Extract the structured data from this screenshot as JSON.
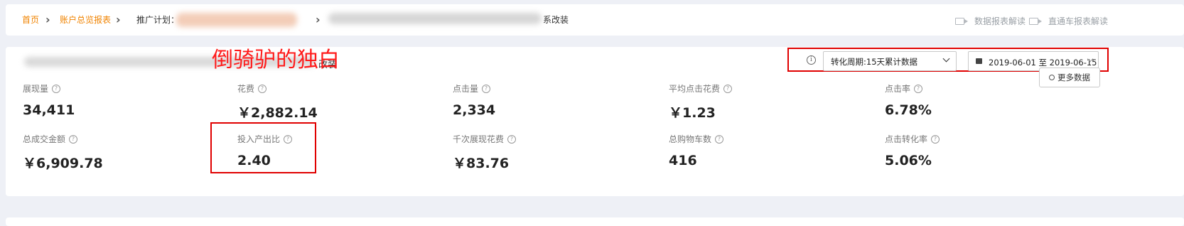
{
  "breadcrumb": {
    "home": "首页",
    "overview": "账户总览报表",
    "plan_label": "推广计划：",
    "item_suffix": "系改装"
  },
  "toolbar": {
    "report_guide": "数据报表解读",
    "through_train_guide": "直通车报表解读"
  },
  "annotation": {
    "text": "倒骑驴的独白",
    "under_text": "改装"
  },
  "filters": {
    "cycle_value": "转化周期:15天累计数据",
    "date_start": "2019-06-01",
    "date_to": "至",
    "date_end": "2019-06-15",
    "more_label": "更多数据"
  },
  "metrics": [
    {
      "label": "展现量",
      "value": "34,411"
    },
    {
      "label": "花费",
      "value": "￥2,882.14"
    },
    {
      "label": "点击量",
      "value": "2,334"
    },
    {
      "label": "平均点击花费",
      "value": "￥1.23"
    },
    {
      "label": "点击率",
      "value": "6.78%"
    },
    {
      "label": "总成交金额",
      "value": "￥6,909.78"
    },
    {
      "label": "投入产出比",
      "value": "2.40"
    },
    {
      "label": "千次展现花费",
      "value": "￥83.76"
    },
    {
      "label": "总购物车数",
      "value": "416"
    },
    {
      "label": "点击转化率",
      "value": "5.06%"
    }
  ],
  "colors": {
    "accent": "#f08300",
    "annotation": "#ff1a1a",
    "background": "#eef0f6"
  }
}
